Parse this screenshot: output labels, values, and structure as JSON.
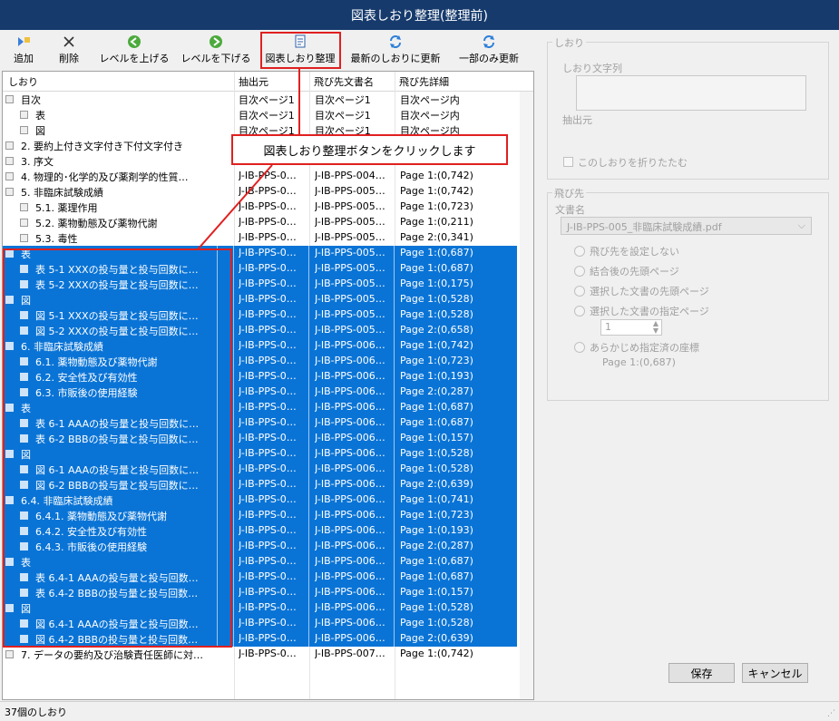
{
  "window": {
    "title": "図表しおり整理(整理前)"
  },
  "toolbar": {
    "add": "追加",
    "delete": "削除",
    "level_up": "レベルを上げる",
    "level_down": "レベルを下げる",
    "organize": "図表しおり整理",
    "refresh_all": "最新のしおりに更新",
    "refresh_partial": "一部のみ更新"
  },
  "columns": {
    "bookmark": "しおり",
    "source": "抽出元",
    "dest_doc": "飛び先文書名",
    "dest_detail": "飛び先詳細"
  },
  "callout": "図表しおり整理ボタンをクリックします",
  "rows": [
    {
      "indent": 0,
      "label": "目次",
      "src": "目次ページ1",
      "doc": "目次ページ1",
      "det": "目次ページ内",
      "sel": false
    },
    {
      "indent": 1,
      "label": "表",
      "src": "目次ページ1",
      "doc": "目次ページ1",
      "det": "目次ページ内",
      "sel": false
    },
    {
      "indent": 1,
      "label": "図",
      "src": "目次ページ1",
      "doc": "目次ページ1",
      "det": "目次ページ内",
      "sel": false
    },
    {
      "indent": 0,
      "label": "2. 要約上付き文字付き下付文字付き",
      "src": "",
      "doc": "",
      "det": "",
      "sel": false
    },
    {
      "indent": 0,
      "label": "3. 序文",
      "src": "",
      "doc": "",
      "det": "",
      "sel": false
    },
    {
      "indent": 0,
      "label": "4. 物理的･化学的及び薬剤学的性質…",
      "src": "J-IB-PPS-0…",
      "doc": "J-IB-PPS-004…",
      "det": "Page 1:(0,742)",
      "sel": false
    },
    {
      "indent": 0,
      "label": "5. 非臨床試験成績",
      "src": "J-IB-PPS-0…",
      "doc": "J-IB-PPS-005…",
      "det": "Page 1:(0,742)",
      "sel": false
    },
    {
      "indent": 1,
      "label": "5.1. 薬理作用",
      "src": "J-IB-PPS-0…",
      "doc": "J-IB-PPS-005…",
      "det": "Page 1:(0,723)",
      "sel": false
    },
    {
      "indent": 1,
      "label": "5.2. 薬物動態及び薬物代謝",
      "src": "J-IB-PPS-0…",
      "doc": "J-IB-PPS-005…",
      "det": "Page 1:(0,211)",
      "sel": false
    },
    {
      "indent": 1,
      "label": "5.3. 毒性",
      "src": "J-IB-PPS-0…",
      "doc": "J-IB-PPS-005…",
      "det": "Page 2:(0,341)",
      "sel": false
    },
    {
      "indent": 0,
      "label": "表",
      "src": "J-IB-PPS-0…",
      "doc": "J-IB-PPS-005…",
      "det": "Page 1:(0,687)",
      "sel": true
    },
    {
      "indent": 1,
      "label": "表 5-1 XXXの投与量と投与回数に…",
      "src": "J-IB-PPS-0…",
      "doc": "J-IB-PPS-005…",
      "det": "Page 1:(0,687)",
      "sel": true
    },
    {
      "indent": 1,
      "label": "表 5-2 XXXの投与量と投与回数に…",
      "src": "J-IB-PPS-0…",
      "doc": "J-IB-PPS-005…",
      "det": "Page 1:(0,175)",
      "sel": true
    },
    {
      "indent": 0,
      "label": "図",
      "src": "J-IB-PPS-0…",
      "doc": "J-IB-PPS-005…",
      "det": "Page 1:(0,528)",
      "sel": true
    },
    {
      "indent": 1,
      "label": "図 5-1 XXXの投与量と投与回数に…",
      "src": "J-IB-PPS-0…",
      "doc": "J-IB-PPS-005…",
      "det": "Page 1:(0,528)",
      "sel": true
    },
    {
      "indent": 1,
      "label": "図 5-2 XXXの投与量と投与回数に…",
      "src": "J-IB-PPS-0…",
      "doc": "J-IB-PPS-005…",
      "det": "Page 2:(0,658)",
      "sel": true
    },
    {
      "indent": 0,
      "label": "6. 非臨床試験成績",
      "src": "J-IB-PPS-0…",
      "doc": "J-IB-PPS-006…",
      "det": "Page 1:(0,742)",
      "sel": true
    },
    {
      "indent": 1,
      "label": "6.1. 薬物動態及び薬物代謝",
      "src": "J-IB-PPS-0…",
      "doc": "J-IB-PPS-006…",
      "det": "Page 1:(0,723)",
      "sel": true
    },
    {
      "indent": 1,
      "label": "6.2. 安全性及び有効性",
      "src": "J-IB-PPS-0…",
      "doc": "J-IB-PPS-006…",
      "det": "Page 1:(0,193)",
      "sel": true
    },
    {
      "indent": 1,
      "label": "6.3. 市販後の使用経験",
      "src": "J-IB-PPS-0…",
      "doc": "J-IB-PPS-006…",
      "det": "Page 2:(0,287)",
      "sel": true
    },
    {
      "indent": 0,
      "label": "表",
      "src": "J-IB-PPS-0…",
      "doc": "J-IB-PPS-006…",
      "det": "Page 1:(0,687)",
      "sel": true
    },
    {
      "indent": 1,
      "label": "表 6-1 AAAの投与量と投与回数に…",
      "src": "J-IB-PPS-0…",
      "doc": "J-IB-PPS-006…",
      "det": "Page 1:(0,687)",
      "sel": true
    },
    {
      "indent": 1,
      "label": "表 6-2 BBBの投与量と投与回数に…",
      "src": "J-IB-PPS-0…",
      "doc": "J-IB-PPS-006…",
      "det": "Page 1:(0,157)",
      "sel": true
    },
    {
      "indent": 0,
      "label": "図",
      "src": "J-IB-PPS-0…",
      "doc": "J-IB-PPS-006…",
      "det": "Page 1:(0,528)",
      "sel": true
    },
    {
      "indent": 1,
      "label": "図 6-1 AAAの投与量と投与回数に…",
      "src": "J-IB-PPS-0…",
      "doc": "J-IB-PPS-006…",
      "det": "Page 1:(0,528)",
      "sel": true
    },
    {
      "indent": 1,
      "label": "図 6-2 BBBの投与量と投与回数に…",
      "src": "J-IB-PPS-0…",
      "doc": "J-IB-PPS-006…",
      "det": "Page 2:(0,639)",
      "sel": true
    },
    {
      "indent": 0,
      "label": "6.4. 非臨床試験成績",
      "src": "J-IB-PPS-0…",
      "doc": "J-IB-PPS-006…",
      "det": "Page 1:(0,741)",
      "sel": true
    },
    {
      "indent": 1,
      "label": "6.4.1. 薬物動態及び薬物代謝",
      "src": "J-IB-PPS-0…",
      "doc": "J-IB-PPS-006…",
      "det": "Page 1:(0,723)",
      "sel": true
    },
    {
      "indent": 1,
      "label": "6.4.2. 安全性及び有効性",
      "src": "J-IB-PPS-0…",
      "doc": "J-IB-PPS-006…",
      "det": "Page 1:(0,193)",
      "sel": true
    },
    {
      "indent": 1,
      "label": "6.4.3. 市販後の使用経験",
      "src": "J-IB-PPS-0…",
      "doc": "J-IB-PPS-006…",
      "det": "Page 2:(0,287)",
      "sel": true
    },
    {
      "indent": 0,
      "label": "表",
      "src": "J-IB-PPS-0…",
      "doc": "J-IB-PPS-006…",
      "det": "Page 1:(0,687)",
      "sel": true
    },
    {
      "indent": 1,
      "label": "表 6.4-1 AAAの投与量と投与回数…",
      "src": "J-IB-PPS-0…",
      "doc": "J-IB-PPS-006…",
      "det": "Page 1:(0,687)",
      "sel": true
    },
    {
      "indent": 1,
      "label": "表 6.4-2 BBBの投与量と投与回数…",
      "src": "J-IB-PPS-0…",
      "doc": "J-IB-PPS-006…",
      "det": "Page 1:(0,157)",
      "sel": true
    },
    {
      "indent": 0,
      "label": "図",
      "src": "J-IB-PPS-0…",
      "doc": "J-IB-PPS-006…",
      "det": "Page 1:(0,528)",
      "sel": true
    },
    {
      "indent": 1,
      "label": "図 6.4-1 AAAの投与量と投与回数…",
      "src": "J-IB-PPS-0…",
      "doc": "J-IB-PPS-006…",
      "det": "Page 1:(0,528)",
      "sel": true
    },
    {
      "indent": 1,
      "label": "図 6.4-2 BBBの投与量と投与回数…",
      "src": "J-IB-PPS-0…",
      "doc": "J-IB-PPS-006…",
      "det": "Page 2:(0,639)",
      "sel": true
    },
    {
      "indent": 0,
      "label": "7. データの要約及び治験責任医師に対…",
      "src": "J-IB-PPS-0…",
      "doc": "J-IB-PPS-007…",
      "det": "Page 1:(0,742)",
      "sel": false
    }
  ],
  "bookmark_panel": {
    "group_title": "しおり",
    "text_label": "しおり文字列",
    "source_label": "抽出元",
    "fold_label": "このしおりを折りたたむ"
  },
  "dest_panel": {
    "group_title": "飛び先",
    "doc_label": "文書名",
    "doc_value": "J-IB-PPS-005_非臨床試験成績.pdf",
    "options": [
      "飛び先を設定しない",
      "結合後の先頭ページ",
      "選択した文書の先頭ページ",
      "選択した文書の指定ページ",
      "あらかじめ指定済の座標"
    ],
    "page_value": "1",
    "coord_value": "Page 1:(0,687)"
  },
  "buttons": {
    "save": "保存",
    "cancel": "キャンセル"
  },
  "status": "37個のしおり",
  "colors": {
    "titlebar": "#163a6c",
    "selection": "#0a74d6",
    "annotation": "#e02020"
  }
}
